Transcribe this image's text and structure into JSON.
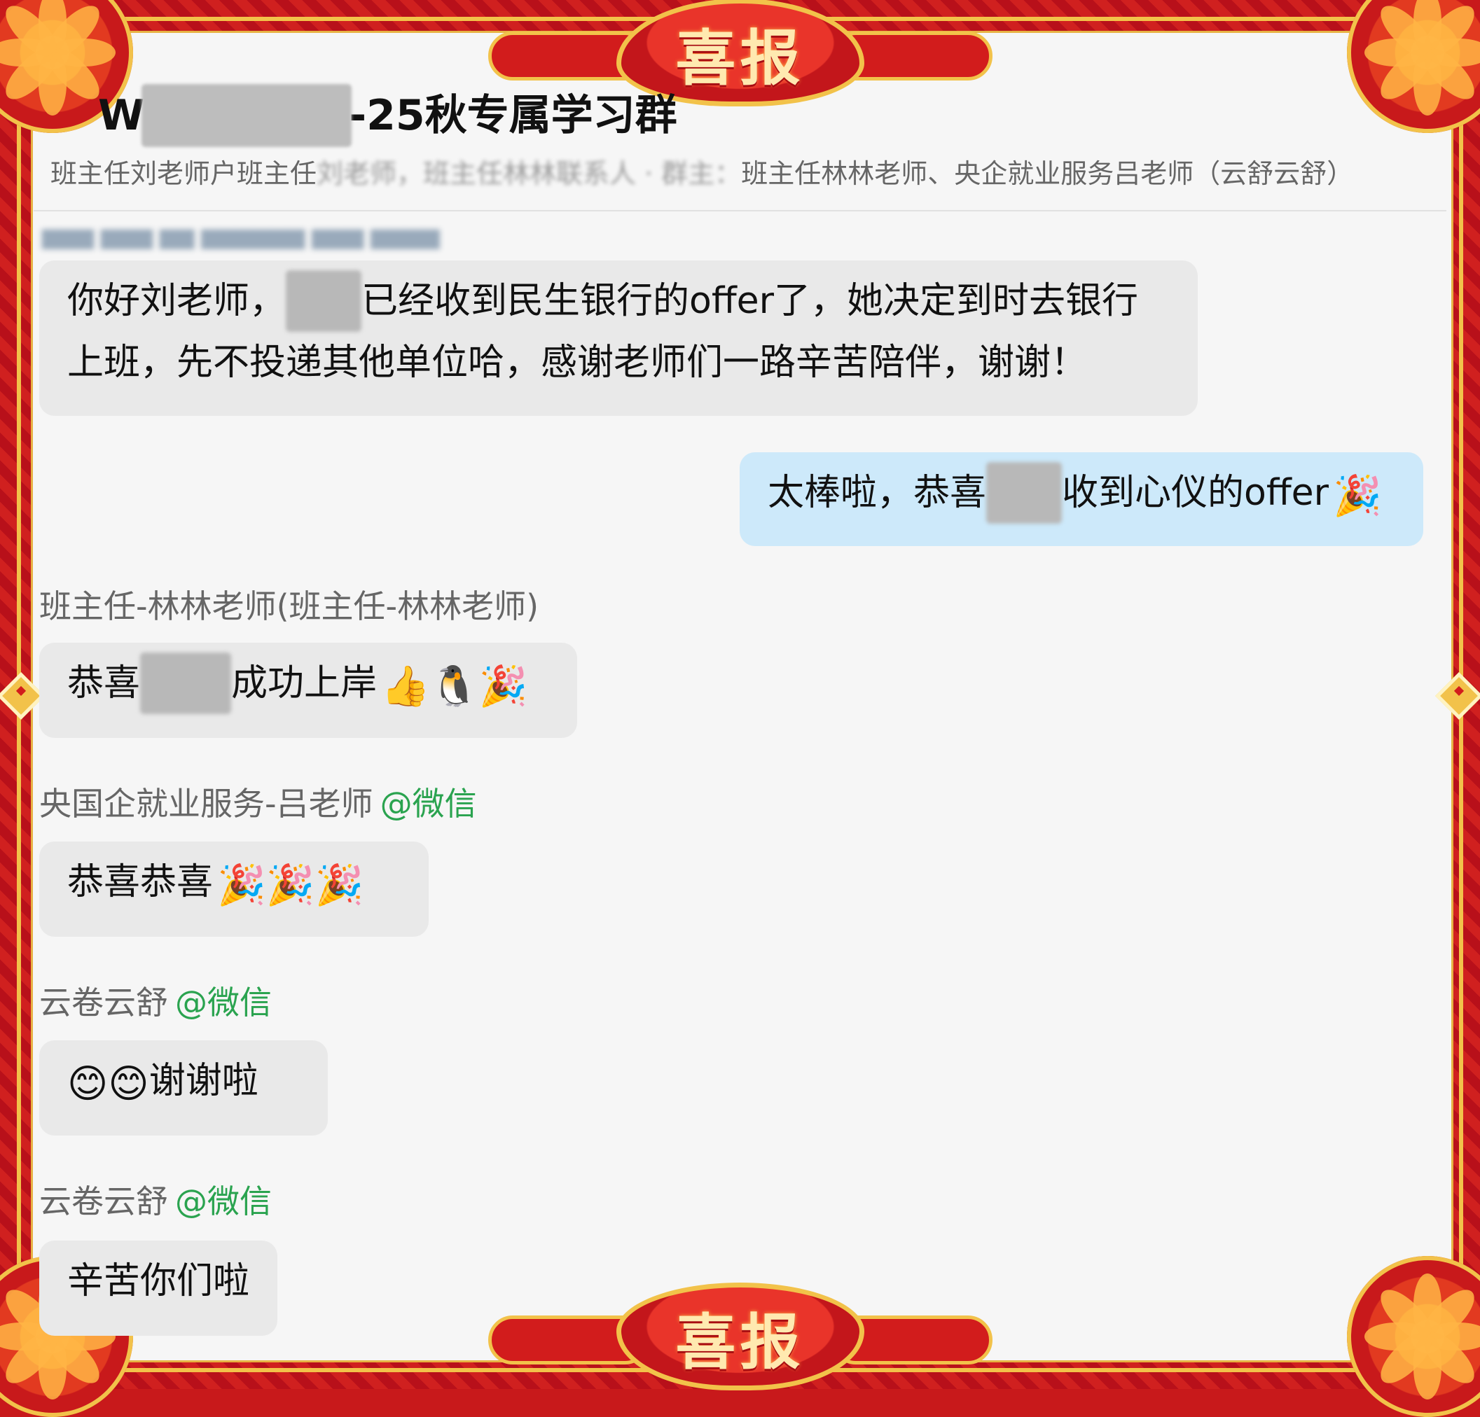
{
  "banner": {
    "top_text": "喜报",
    "bottom_text": "喜报"
  },
  "chat": {
    "title_prefix": "W",
    "title_suffix": "-25秋专属学习群",
    "members_visible": "班主任刘老师户班主任",
    "members_blurred": "刘老师，班主任林林联系人 · 群主：",
    "members_rest": "班主任林林老师、央企就业服务吕老师（云舒云舒）"
  },
  "messages": [
    {
      "sender": "",
      "text_before": "你好刘老师，",
      "text_after": "已经收到民生银行的offer了，她决定到时去银行",
      "text_line2": "上班，先不投递其他单位哈，感谢老师们一路辛苦陪伴，谢谢！"
    },
    {
      "sender": "",
      "text_before": "太棒啦，恭喜",
      "text_after": "收到心仪的offer",
      "emoji": "🎉"
    },
    {
      "sender": "班主任-林林老师(班主任-林林老师)",
      "text_before": "恭喜",
      "text_after": "成功上岸",
      "emoji": "👍🐧🎉"
    },
    {
      "sender": "央国企就业服务-吕老师",
      "sender_suffix": "@微信",
      "text": "恭喜恭喜",
      "emoji": "🎉🎉🎉"
    },
    {
      "sender": "云卷云舒",
      "sender_suffix": "@微信",
      "emoji": "😊😊",
      "text": "谢谢啦"
    },
    {
      "sender": "云卷云舒",
      "sender_suffix": "@微信",
      "text": "辛苦你们啦"
    }
  ]
}
